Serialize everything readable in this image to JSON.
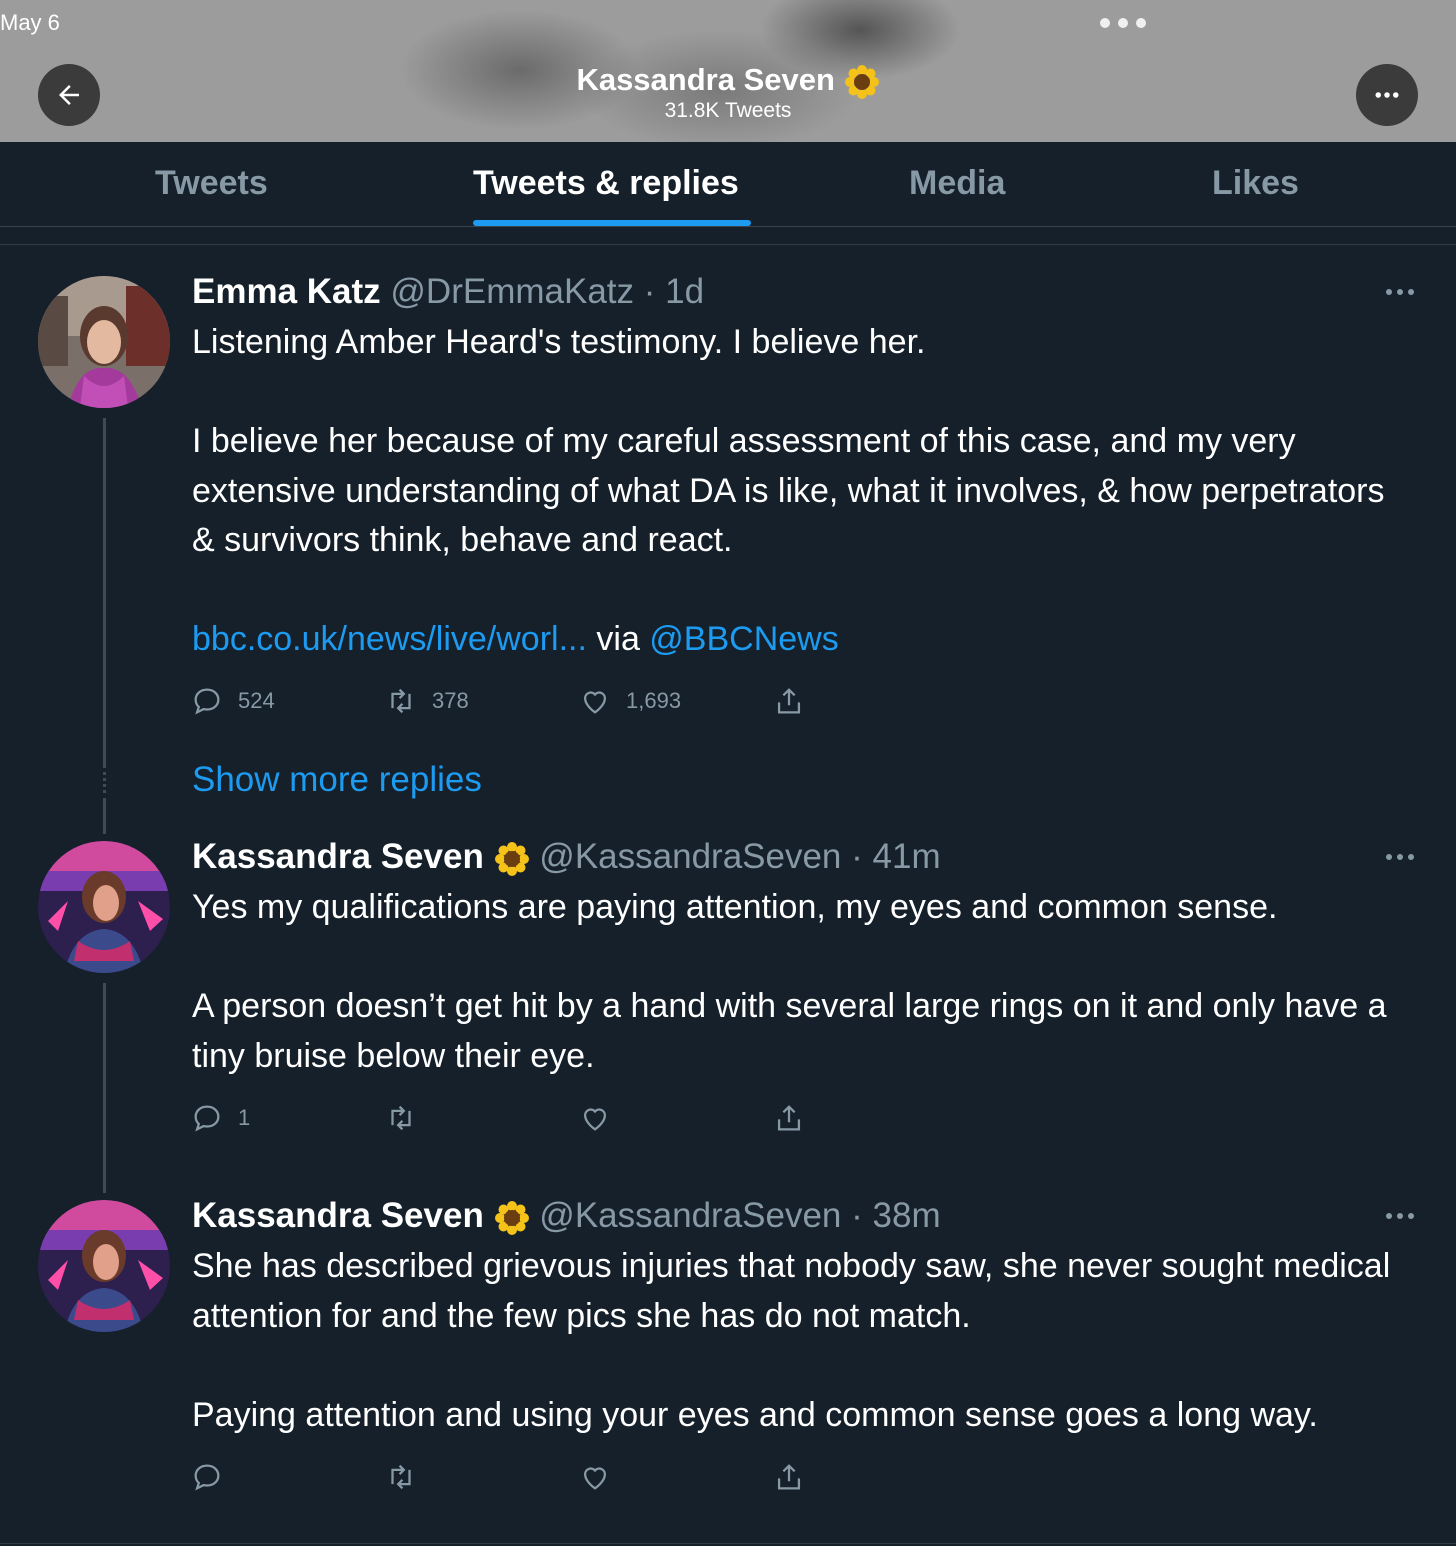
{
  "status_bar": {
    "date": "May 6"
  },
  "header": {
    "title": "Kassandra Seven",
    "subtitle": "31.8K Tweets"
  },
  "tabs": [
    {
      "label": "Tweets"
    },
    {
      "label": "Tweets & replies"
    },
    {
      "label": "Media"
    },
    {
      "label": "Likes"
    }
  ],
  "tweets": [
    {
      "name": "Emma Katz",
      "handle": "@DrEmmaKatz",
      "time": "· 1d",
      "text": "Listening Amber Heard's testimony. I believe her.\n\nI believe her because of my careful assessment of this case, and my very extensive understanding of what DA is like, what it involves, & how perpetrators & survivors think, behave and react.\n\n",
      "link_text": "bbc.co.uk/news/live/worl...",
      "via_text": " via ",
      "mention": "@BBCNews",
      "replies": "524",
      "retweets": "378",
      "likes": "1,693"
    },
    {
      "name": "Kassandra Seven",
      "handle": "@KassandraSeven",
      "time": "· 41m",
      "text": "Yes my qualifications are paying attention, my eyes and common sense.\n\nA person doesn’t get hit by a hand with several large rings on it and only have a tiny bruise below their eye.",
      "replies": "1"
    },
    {
      "name": "Kassandra Seven",
      "handle": "@KassandraSeven",
      "time": "· 38m",
      "text": "She has described grievous injuries that nobody saw, she never sought medical attention for and the few pics she has do not match.\n\nPaying attention and using your eyes and common sense goes a long way."
    }
  ],
  "show_more_replies": "Show more replies",
  "colors": {
    "background": "#15202b",
    "accent": "#1d9bf0",
    "muted": "#8899a6"
  }
}
